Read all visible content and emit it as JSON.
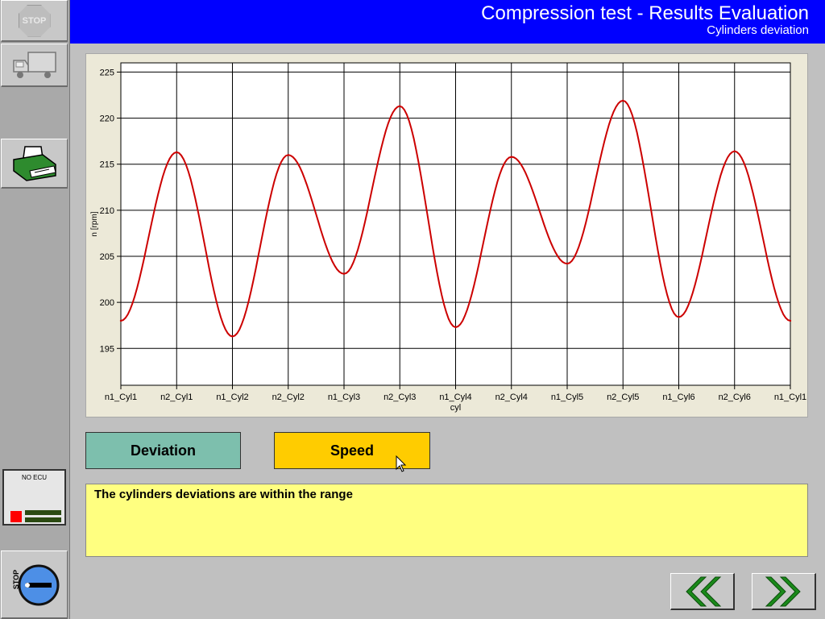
{
  "header": {
    "title": "Compression test - Results Evaluation",
    "subtitle": "Cylinders deviation"
  },
  "sidebar": {
    "stop_top_label": "STOP",
    "ecu_label": "NO ECU",
    "stop_bottom_label": "STOP"
  },
  "buttons": {
    "deviation": "Deviation",
    "speed": "Speed"
  },
  "message": "The cylinders deviations are within the range",
  "colors": {
    "header_bg": "#0000ff",
    "series": "#cc0000",
    "deviation_btn": "#7dbfad",
    "speed_btn": "#ffcc00",
    "message_bg": "#ffff80",
    "nav_arrow": "#1a8a1a"
  },
  "icons": {
    "stop_top": "stop-sign-icon",
    "truck": "truck-icon",
    "print": "printer-icon",
    "stop_bottom": "stop-button-icon",
    "prev": "double-chevron-left-icon",
    "next": "double-chevron-right-icon"
  },
  "chart_data": {
    "type": "line",
    "xlabel": "cyl",
    "ylabel": "n [rpm]",
    "categories": [
      "n1_Cyl1",
      "n2_Cyl1",
      "n1_Cyl2",
      "n2_Cyl2",
      "n1_Cyl3",
      "n2_Cyl3",
      "n1_Cyl4",
      "n2_Cyl4",
      "n1_Cyl5",
      "n2_Cyl5",
      "n1_Cyl6",
      "n2_Cyl6",
      "n1_Cyl1"
    ],
    "series": [
      {
        "values": [
          198.0,
          216.3,
          196.3,
          216.0,
          203.1,
          221.3,
          197.3,
          215.8,
          204.2,
          221.9,
          198.4,
          216.4,
          198.0
        ]
      }
    ],
    "ylim": [
      191,
      226
    ],
    "yticks": [
      195,
      200,
      205,
      210,
      215,
      220,
      225
    ],
    "grid": true,
    "legend": "none"
  }
}
